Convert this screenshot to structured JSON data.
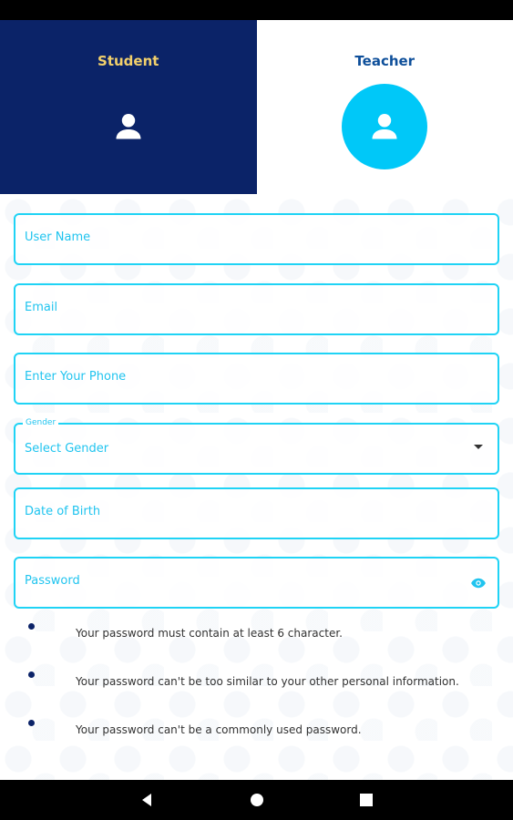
{
  "roles": {
    "student": {
      "label": "Student",
      "icon": "person-icon"
    },
    "teacher": {
      "label": "Teacher",
      "icon": "person-icon"
    },
    "selected": "Teacher"
  },
  "colors": {
    "student_bg": "#0b2368",
    "student_label": "#f2d06b",
    "teacher_label": "#0e4f9a",
    "teacher_avatar": "#00c8f8",
    "field_border": "#1fd3f5"
  },
  "form": {
    "username": {
      "placeholder": "User Name",
      "value": ""
    },
    "email": {
      "placeholder": "Email",
      "value": ""
    },
    "phone": {
      "placeholder": "Enter Your Phone",
      "value": ""
    },
    "gender": {
      "label": "Gender",
      "selected": "Select Gender"
    },
    "dob": {
      "placeholder": "Date of Birth",
      "value": ""
    },
    "password": {
      "placeholder": "Password",
      "value": "",
      "icon": "eye-icon"
    }
  },
  "password_rules": [
    "Your password must contain at least 6 character.",
    "Your password can't be too similar to your other personal information.",
    "Your password can't be a commonly used password."
  ],
  "nav": {
    "back": "back-icon",
    "home": "home-icon",
    "recents": "recents-icon"
  }
}
